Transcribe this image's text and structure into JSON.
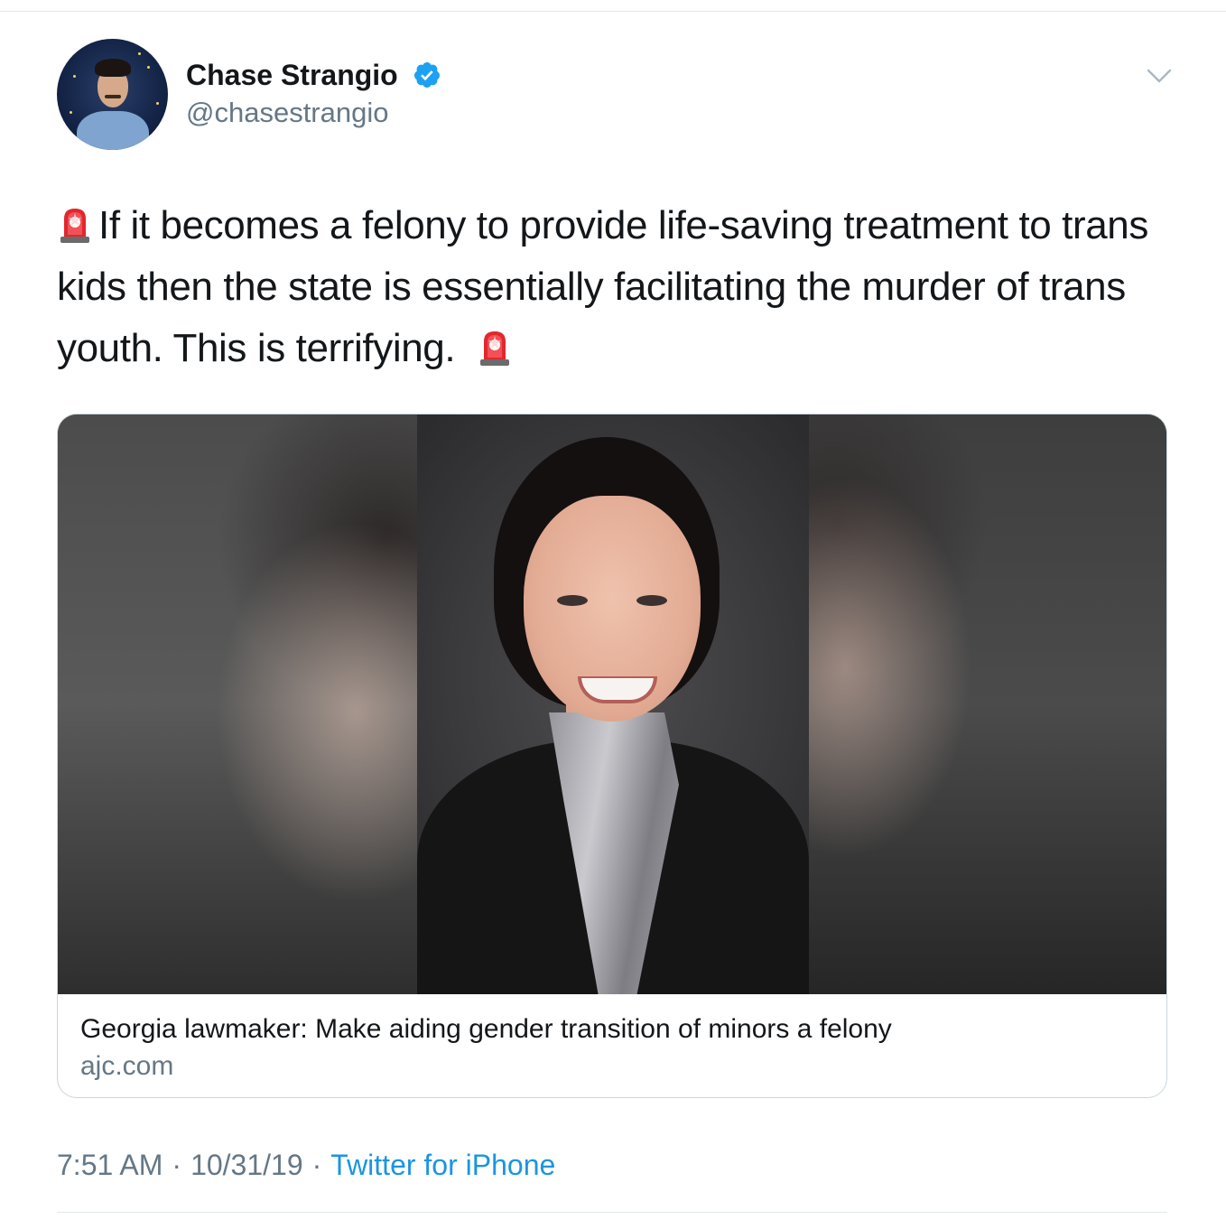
{
  "author": {
    "display_name": "Chase Strangio",
    "handle": "@chasestrangio",
    "verified": true,
    "verified_color": "#1da1f2"
  },
  "tweet": {
    "text_part1": "If it becomes a felony to provide life-saving treatment to trans kids then the state is essentially facilitating the murder of trans youth. This is terrifying.",
    "emoji": "police-car-light"
  },
  "card": {
    "title": "Georgia lawmaker: Make aiding gender transition of minors a felony",
    "domain": "ajc.com"
  },
  "meta": {
    "time": "7:51 AM",
    "separator": "·",
    "date": "10/31/19",
    "source": "Twitter for iPhone",
    "source_color": "#1b95e0"
  },
  "colors": {
    "text": "#14171a",
    "secondary": "#657786",
    "border": "#ccd6dd"
  }
}
